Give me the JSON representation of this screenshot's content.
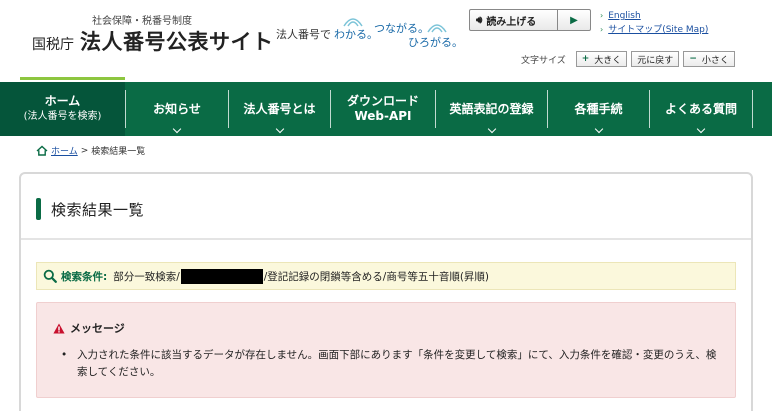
{
  "header": {
    "logo_sub": "社会保障・税番号制度",
    "logo_agency": "国税庁",
    "logo_main": "法人番号公表サイト",
    "tagline_prefix": "法人番号で",
    "tagline_a": "わかる。",
    "tagline_b": "つながる。",
    "tagline_c": "ひろがる。",
    "read_aloud_label": "読み上げる",
    "english_link": "English",
    "sitemap_link": "サイトマップ(Site Map)",
    "font_size_label": "文字サイズ",
    "font_larger": "大きく",
    "font_reset": "元に戻す",
    "font_smaller": "小さく"
  },
  "nav": {
    "items": [
      {
        "line1": "ホーム",
        "line2": "(法人番号を検索)"
      },
      {
        "line1": "お知らせ"
      },
      {
        "line1": "法人番号とは"
      },
      {
        "line1": "ダウンロード",
        "line2": "Web-API"
      },
      {
        "line1": "英語表記の登録"
      },
      {
        "line1": "各種手続"
      },
      {
        "line1": "よくある質問"
      }
    ]
  },
  "breadcrumb": {
    "home": "ホーム",
    "separator": ">",
    "current": "検索結果一覧"
  },
  "main": {
    "title": "検索結果一覧",
    "condition_label": "検索条件:",
    "condition_prefix": "部分一致検索/",
    "condition_suffix": "/登記記録の閉鎖等含める/商号等五十音順(昇順)",
    "message_title": "メッセージ",
    "message_text": "入力された条件に該当するデータが存在しません。画面下部にあります「条件を変更して検索」にて、入力条件を確認・変更のうえ、検索してください。"
  },
  "colors": {
    "brand_green": "#0a6b45",
    "accent_lightgreen": "#8dc63f",
    "condition_bg": "#fbf8dc",
    "message_bg": "#f9e6e6",
    "warning_red": "#c8102e"
  }
}
